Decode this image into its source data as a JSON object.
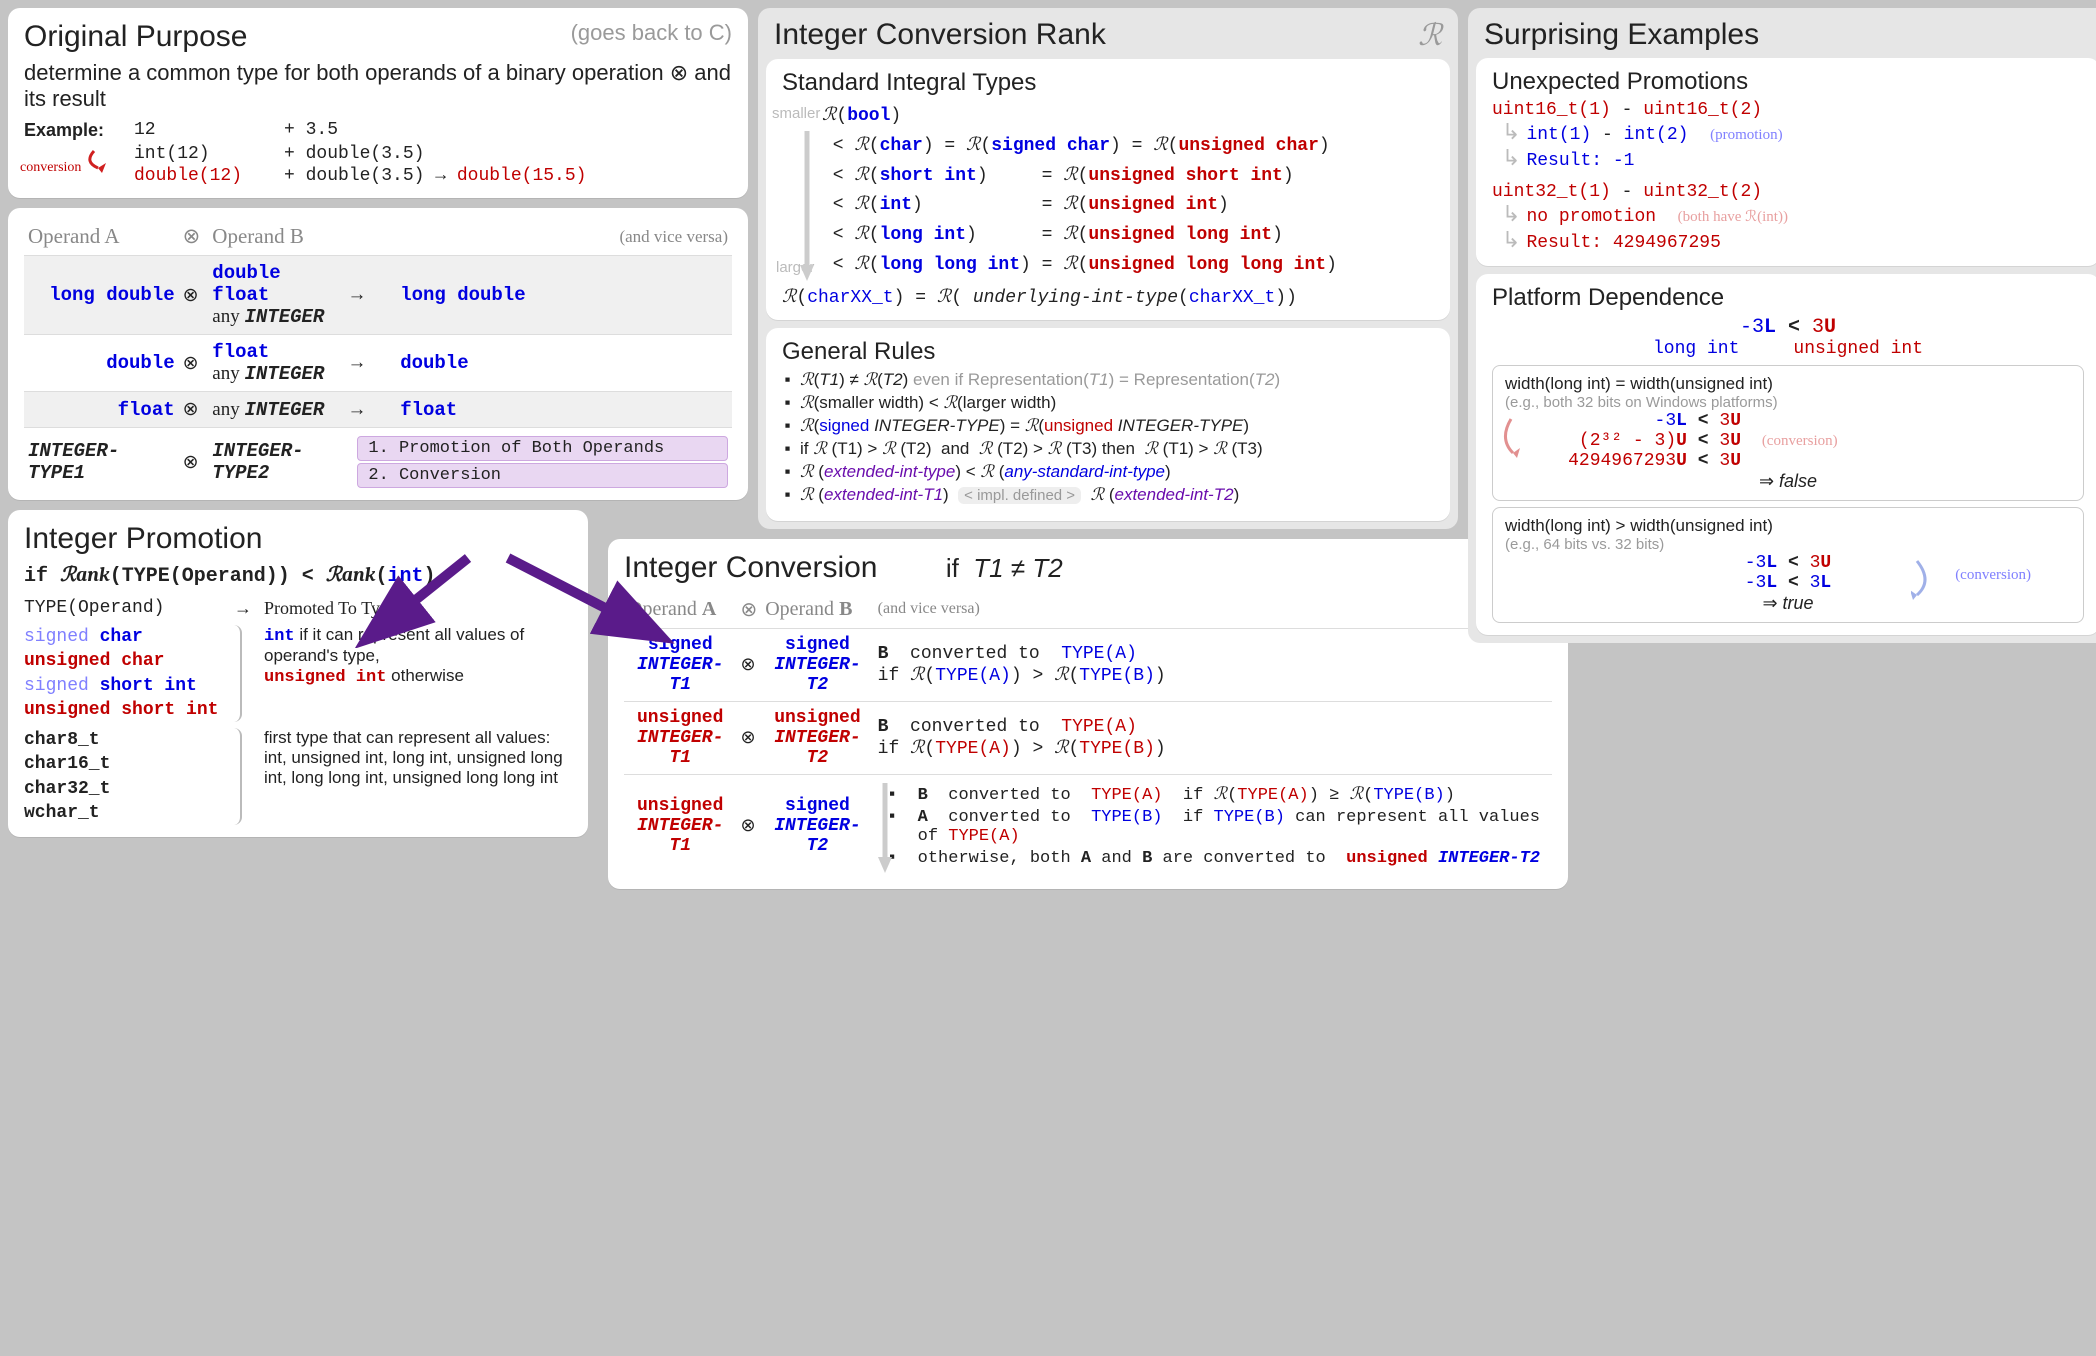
{
  "purpose": {
    "title": "Original Purpose",
    "subtitle": "(goes back to C)",
    "desc": "determine a common type for both operands of a binary operation ⊗ and its result",
    "example_label": "Example:",
    "conversion_label": "conversion",
    "ex_l1_a": "12",
    "ex_l1_b": "+ 3.5",
    "ex_l2_a": "int(12)",
    "ex_l2_b": "+ double(3.5)",
    "ex_l3_a": "double(12)",
    "ex_l3_op": " + ",
    "ex_l3_b": "double(3.5)",
    "ex_l3_arr": " → ",
    "ex_l3_r": "double(15.5)"
  },
  "typetable": {
    "headA": "Operand A",
    "headB": "Operand B",
    "vice": "(and vice versa)",
    "op": "⊗",
    "rows": {
      "r1a": "long double",
      "r1b1": "double",
      "r1b2": "float",
      "r1b3": "any INTEGER",
      "r1r": "long double",
      "r2a": "double",
      "r2b1": "float",
      "r2b2": "any INTEGER",
      "r2r": "double",
      "r3a": "float",
      "r3b": "any INTEGER",
      "r3r": "float",
      "r4a": "INTEGER-TYPE1",
      "r4b": "INTEGER-TYPE2",
      "tag1": "1. Promotion of Both Operands",
      "tag2": "2. Conversion"
    }
  },
  "rank": {
    "title": "Integer Conversion Rank",
    "R": "ℛ",
    "std_title": "Standard Integral Types",
    "smaller": "smaller",
    "larger": "larger",
    "l1": "ℛ(bool)",
    "l2": "< ℛ(char) = ℛ(signed char) = ℛ(unsigned char)",
    "l3": "< ℛ(short int)     = ℛ(unsigned short int)",
    "l4": "< ℛ(int)           = ℛ(unsigned int)",
    "l5": "< ℛ(long int)      = ℛ(unsigned long int)",
    "l6": "< ℛ(long long int) = ℛ(unsigned long long int)",
    "charxx": "ℛ(charXX_t) = ℛ( underlying-int-type(charXX_t))",
    "gen_title": "General Rules",
    "g1": "ℛ(T1) ≠ ℛ(T2)  even if Representation(T1) = Representation(T2)",
    "g2": "ℛ(smaller width) < ℛ(larger width)",
    "g3": "ℛ(signed INTEGER-TYPE) = ℛ(unsigned INTEGER-TYPE)",
    "g4": "if ℛ (T1) > ℛ (T2)  and  ℛ (T2) > ℛ (T3) then  ℛ (T1) > ℛ (T3)",
    "g5": "ℛ (extended-int-type) < ℛ (any-standard-int-type)",
    "g6a": "ℛ (extended-int-T1)",
    "g6chip": "< impl. defined >",
    "g6b": "ℛ (extended-int-T2)"
  },
  "promotion": {
    "title": "Integer Promotion",
    "cond": "if ℛank(TYPE(Operand)) < ℛank(int)",
    "colL": "TYPE(Operand)",
    "arrow": "→",
    "colR": "Promoted To Type",
    "t1": "signed char",
    "t2": "unsigned char",
    "t3": "signed short int",
    "t4": "unsigned short int",
    "r1a": "int",
    "r1b": " if it can represent all values of operand's type,",
    "r2a": "unsigned int",
    "r2b": " otherwise",
    "c1": "char8_t",
    "c2": "char16_t",
    "c3": "char32_t",
    "c4": "wchar_t",
    "cdesc": "first type that can represent all values: int, unsigned int, long int, unsigned long int, long long int, unsigned long long int"
  },
  "conversion": {
    "title": "Integer Conversion",
    "cond": "if  T1 ≠ T2",
    "headA": "Operand A",
    "headB": "Operand B",
    "vice": "(and vice versa)",
    "op": "⊗",
    "r1a": "signed INTEGER-T1",
    "r1b": "signed INTEGER-T2",
    "r1r1": "B  converted to  TYPE(A)",
    "r1r2": "if ℛ(TYPE(A)) > ℛ(TYPE(B))",
    "r2a": "unsigned INTEGER-T1",
    "r2b": "unsigned INTEGER-T2",
    "r2r1": "B  converted to  TYPE(A)",
    "r2r2": "if ℛ(TYPE(A)) > ℛ(TYPE(B))",
    "r3a": "unsigned INTEGER-T1",
    "r3b": "signed INTEGER-T2",
    "b1": "B  converted to  TYPE(A)  if ℛ(TYPE(A)) ≥ ℛ(TYPE(B))",
    "b2": "A  converted to  TYPE(B)  if TYPE(B) can represent all values of TYPE(A)",
    "b3": "otherwise, both A and B are converted to  unsigned INTEGER-T2"
  },
  "surprising": {
    "title": "Surprising Examples",
    "unexp_title": "Unexpected Promotions",
    "u1": "uint16_t(1) - uint16_t(2)",
    "u1a": "int(1) - int(2)",
    "u1note": "(promotion)",
    "u1res": "Result: -1",
    "u2": "uint32_t(1) - uint32_t(2)",
    "u2a": "no promotion",
    "u2note": "(both have ℛ(int))",
    "u2res": "Result: 4294967295",
    "plat_title": "Platform Dependence",
    "p_exp": "-3L < 3U",
    "p_t1": "long int",
    "p_t2": "unsigned int",
    "box1_h": "width(long int) = width(unsigned int)",
    "box1_eg": "(e.g., both 32 bits on Windows platforms)",
    "box1_l1": "      -3L < 3U",
    "box1_l2": "(2³² - 3)U < 3U",
    "box1_note": "(conversion)",
    "box1_l3": "4294967293U < 3U",
    "box1_res": "⇒ false",
    "box2_h": "width(long int) > width(unsigned int)",
    "box2_eg": "(e.g., 64 bits  vs.  32 bits)",
    "box2_l1": "-3L < 3U",
    "box2_l2": "-3L < 3L",
    "box2_note": "(conversion)",
    "box2_res": "⇒ true"
  }
}
